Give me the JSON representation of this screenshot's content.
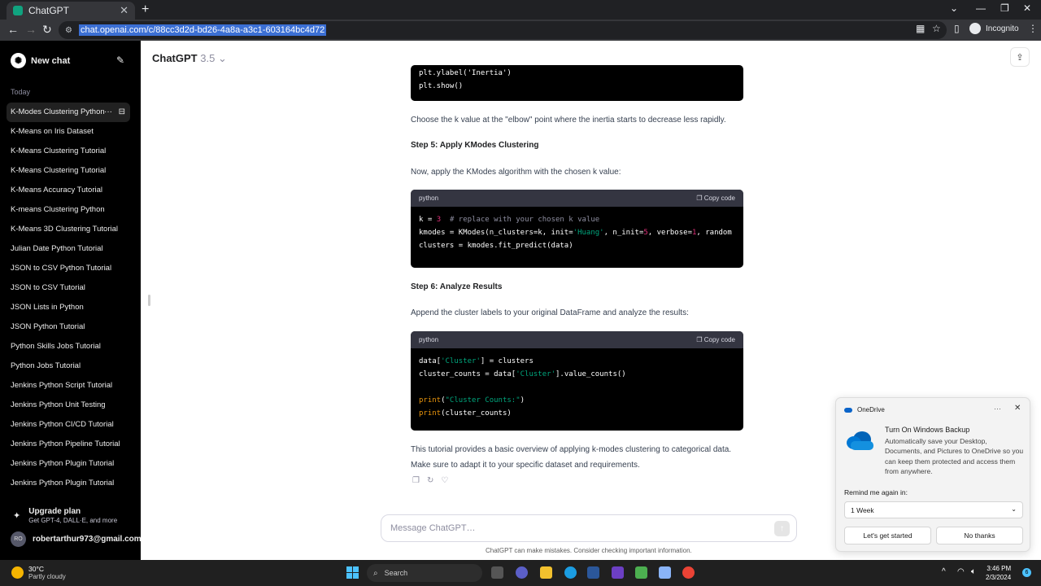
{
  "browser": {
    "tab_title": "ChatGPT",
    "tab_close": "✕",
    "new_tab": "+",
    "url": "chat.openai.com/c/88cc3d2d-bd26-4a8a-a3c1-603164bc4d72",
    "profile": "Incognito"
  },
  "sidebar": {
    "new_chat": "New chat",
    "section_label": "Today",
    "items": [
      {
        "label": "K-Modes Clustering Python"
      },
      {
        "label": "K-Means on Iris Dataset"
      },
      {
        "label": "K-Means Clustering Tutorial"
      },
      {
        "label": "K-Means Clustering Tutorial"
      },
      {
        "label": "K-Means Accuracy Tutorial"
      },
      {
        "label": "K-means Clustering Python"
      },
      {
        "label": "K-Means 3D Clustering Tutorial"
      },
      {
        "label": "Julian Date Python Tutorial"
      },
      {
        "label": "JSON to CSV Python Tutorial"
      },
      {
        "label": "JSON to CSV Tutorial"
      },
      {
        "label": "JSON Lists in Python"
      },
      {
        "label": "JSON Python Tutorial"
      },
      {
        "label": "Python Skills Jobs Tutorial"
      },
      {
        "label": "Python Jobs Tutorial"
      },
      {
        "label": "Jenkins Python Script Tutorial"
      },
      {
        "label": "Jenkins Python Unit Testing"
      },
      {
        "label": "Jenkins Python CI/CD Tutorial"
      },
      {
        "label": "Jenkins Python Pipeline Tutorial"
      },
      {
        "label": "Jenkins Python Plugin Tutorial"
      },
      {
        "label": "Jenkins Python Plugin Tutorial"
      }
    ],
    "upgrade_title": "Upgrade plan",
    "upgrade_sub": "Get GPT-4, DALL·E, and more",
    "user_initials": "RO",
    "user_email": "robertarthur973@gmail.com"
  },
  "main": {
    "model_name": "ChatGPT",
    "model_version": "3.5",
    "code1_lines": [
      "plt.ylabel('Inertia')",
      "plt.show()"
    ],
    "para_elbow": "Choose the k value at the \"elbow\" point where the inertia starts to decrease less rapidly.",
    "step5_heading": "Step 5: Apply KModes Clustering",
    "step5_text": "Now, apply the KModes algorithm with the chosen k value:",
    "code_lang": "python",
    "copy_label": "Copy code",
    "step6_heading": "Step 6: Analyze Results",
    "step6_text": "Append the cluster labels to your original DataFrame and analyze the results:",
    "summary_text": "This tutorial provides a basic overview of applying k-modes clustering to categorical data. Make sure to adapt it to your specific dataset and requirements.",
    "input_placeholder": "Message ChatGPT…",
    "disclaimer": "ChatGPT can make mistakes. Consider checking important information."
  },
  "onedrive": {
    "app_name": "OneDrive",
    "heading": "Turn On Windows Backup",
    "body": "Automatically save your Desktop, Documents, and Pictures to OneDrive so you can keep them protected and access them from anywhere.",
    "remind_label": "Remind me again in:",
    "remind_value": "1 Week",
    "primary_button": "Let's get started",
    "secondary_button": "No thanks"
  },
  "taskbar": {
    "temperature": "30°C",
    "condition": "Partly cloudy",
    "search_label": "Search",
    "time": "3:46 PM",
    "date": "2/3/2024",
    "notification_count": "6"
  }
}
